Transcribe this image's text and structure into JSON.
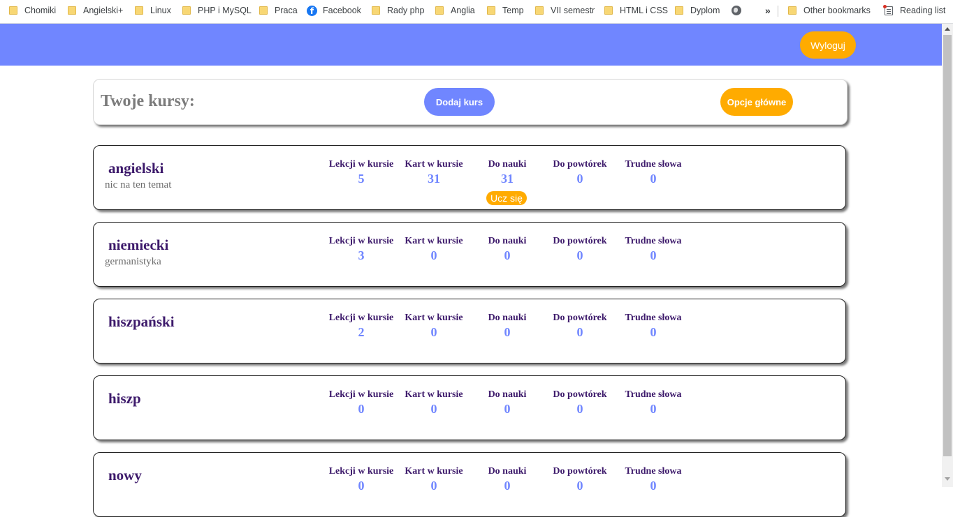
{
  "bookmarks": {
    "items": [
      {
        "label": "Chomiki",
        "icon": "folder-icon"
      },
      {
        "label": "Angielski+",
        "icon": "folder-icon"
      },
      {
        "label": "Linux",
        "icon": "folder-icon"
      },
      {
        "label": "PHP i MySQL",
        "icon": "folder-icon"
      },
      {
        "label": "Praca",
        "icon": "folder-icon"
      },
      {
        "label": "Facebook",
        "icon": "facebook-icon"
      },
      {
        "label": "Rady php",
        "icon": "folder-icon"
      },
      {
        "label": "Anglia",
        "icon": "folder-icon"
      },
      {
        "label": "Temp",
        "icon": "folder-icon"
      },
      {
        "label": "VII semestr",
        "icon": "folder-icon"
      },
      {
        "label": "HTML i CSS",
        "icon": "folder-icon"
      },
      {
        "label": "Dyplom",
        "icon": "folder-icon"
      }
    ],
    "overflow_label": "»",
    "other_bookmarks": "Other bookmarks",
    "reading_list": "Reading list",
    "facebook_glyph": "f"
  },
  "header": {
    "logout_label": "Wyloguj",
    "accent_color": "#7086ff",
    "button_color": "#ffab00"
  },
  "panel": {
    "title": "Twoje kursy:",
    "add_course_label": "Dodaj kurs",
    "main_options_label": "Opcje główne"
  },
  "stat_labels": {
    "lessons": "Lekcji w kursie",
    "cards": "Kart w kursie",
    "to_learn": "Do nauki",
    "to_review": "Do powtórek",
    "hard_words": "Trudne słowa"
  },
  "learn_button_label": "Ucz się",
  "courses": [
    {
      "name": "angielski",
      "description": "nic na ten temat",
      "lessons": "5",
      "cards": "31",
      "to_learn": "31",
      "to_review": "0",
      "hard_words": "0"
    },
    {
      "name": "niemiecki",
      "description": "germanistyka",
      "lessons": "3",
      "cards": "0",
      "to_learn": "0",
      "to_review": "0",
      "hard_words": "0"
    },
    {
      "name": "hiszpański",
      "description": "",
      "lessons": "2",
      "cards": "0",
      "to_learn": "0",
      "to_review": "0",
      "hard_words": "0"
    },
    {
      "name": "hiszp",
      "description": "",
      "lessons": "0",
      "cards": "0",
      "to_learn": "0",
      "to_review": "0",
      "hard_words": "0"
    },
    {
      "name": "nowy",
      "description": "",
      "lessons": "0",
      "cards": "0",
      "to_learn": "0",
      "to_review": "0",
      "hard_words": "0"
    }
  ]
}
